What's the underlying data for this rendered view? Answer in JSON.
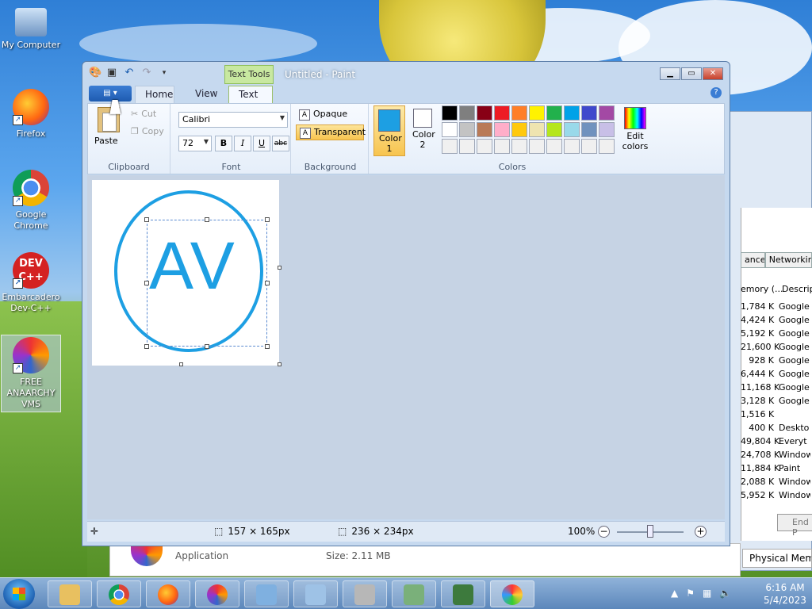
{
  "desktop": {
    "icons": [
      {
        "label": "My Computer"
      },
      {
        "label": "Firefox"
      },
      {
        "label": "Google Chrome"
      },
      {
        "label": "Embarcadero Dev-C++"
      },
      {
        "label": "FREE ANAARCHY VMS"
      }
    ],
    "dev_icon_text": "DEV C++"
  },
  "paint": {
    "title": "Untitled - Paint",
    "contextual_tab": "Text Tools",
    "app_menu_glyph": "▤ ▾",
    "tabs": [
      "Home",
      "View",
      "Text"
    ],
    "active_tab": "Text",
    "help": "?",
    "clipboard": {
      "paste": "Paste",
      "cut": "Cut",
      "copy": "Copy",
      "label": "Clipboard"
    },
    "font": {
      "family": "Calibri",
      "size": "72",
      "bold": "B",
      "italic": "I",
      "underline": "U",
      "strike": "abc",
      "label": "Font"
    },
    "background": {
      "opaque": "Opaque",
      "transparent": "Transparent",
      "selected": "Transparent",
      "label": "Background"
    },
    "colors": {
      "color1_label": "Color 1",
      "color2_label": "Color 2",
      "color1": "#1d9fe3",
      "color2": "#ffffff",
      "edit_colors": "Edit colors",
      "label": "Colors",
      "palette": [
        "#000000",
        "#7f7f7f",
        "#880015",
        "#ed1c24",
        "#ff7f27",
        "#fff200",
        "#22b14c",
        "#00a2e8",
        "#3f48cc",
        "#a349a4",
        "#ffffff",
        "#c3c3c3",
        "#b97a57",
        "#ffaec9",
        "#ffc90e",
        "#efe4b0",
        "#b5e61d",
        "#99d9ea",
        "#7092be",
        "#c8bfe7",
        "#f0f0f0",
        "#f0f0f0",
        "#f0f0f0",
        "#f0f0f0",
        "#f0f0f0",
        "#f0f0f0",
        "#f0f0f0",
        "#f0f0f0",
        "#f0f0f0",
        "#f0f0f0"
      ]
    },
    "canvas": {
      "text": "AV",
      "text_color": "#1d9fe3"
    },
    "status": {
      "selection_size": "157 × 165px",
      "canvas_size": "236 × 234px",
      "zoom": "100%",
      "zoom_level_percent": 100
    }
  },
  "task_manager": {
    "tabs": [
      "ance",
      "Networking"
    ],
    "col_memory": "emory (...",
    "col_desc": "Descrip",
    "rows": [
      {
        "mem": "1,784 K",
        "desc": "Google"
      },
      {
        "mem": "4,424 K",
        "desc": "Google"
      },
      {
        "mem": "5,192 K",
        "desc": "Google"
      },
      {
        "mem": "21,600 K",
        "desc": "Google"
      },
      {
        "mem": "928 K",
        "desc": "Google"
      },
      {
        "mem": "6,444 K",
        "desc": "Google"
      },
      {
        "mem": "11,168 K",
        "desc": "Google"
      },
      {
        "mem": "3,128 K",
        "desc": "Google"
      },
      {
        "mem": "1,516 K",
        "desc": ""
      },
      {
        "mem": "400 K",
        "desc": "Deskto"
      },
      {
        "mem": "49,804 K",
        "desc": "Everyt"
      },
      {
        "mem": "24,708 K",
        "desc": "Window"
      },
      {
        "mem": "11,884 K",
        "desc": "Paint"
      },
      {
        "mem": "2,088 K",
        "desc": "Window"
      },
      {
        "mem": "5,952 K",
        "desc": "Window"
      }
    ],
    "end_button": "End P",
    "physical_memory": "Physical Memo"
  },
  "app_strip": {
    "type": "Application",
    "size": "Size:   2.11 MB"
  },
  "taskbar": {
    "time": "6:16 AM",
    "date": "5/4/2023"
  }
}
